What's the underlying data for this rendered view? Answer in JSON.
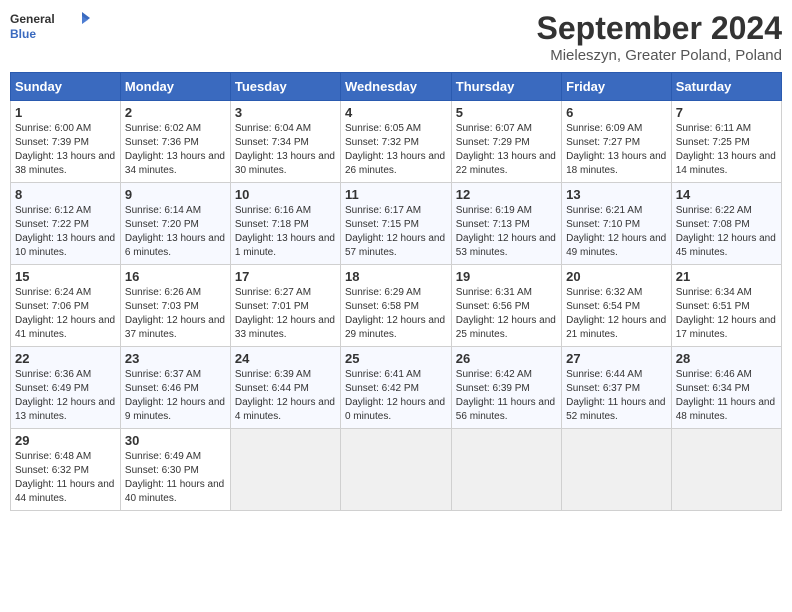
{
  "header": {
    "title": "September 2024",
    "subtitle": "Mieleszyn, Greater Poland, Poland",
    "logo_general": "General",
    "logo_blue": "Blue"
  },
  "days_of_week": [
    "Sunday",
    "Monday",
    "Tuesday",
    "Wednesday",
    "Thursday",
    "Friday",
    "Saturday"
  ],
  "weeks": [
    [
      {
        "day": "1",
        "sr": "6:00 AM",
        "ss": "7:39 PM",
        "dl": "13 hours and 38 minutes."
      },
      {
        "day": "2",
        "sr": "6:02 AM",
        "ss": "7:36 PM",
        "dl": "13 hours and 34 minutes."
      },
      {
        "day": "3",
        "sr": "6:04 AM",
        "ss": "7:34 PM",
        "dl": "13 hours and 30 minutes."
      },
      {
        "day": "4",
        "sr": "6:05 AM",
        "ss": "7:32 PM",
        "dl": "13 hours and 26 minutes."
      },
      {
        "day": "5",
        "sr": "6:07 AM",
        "ss": "7:29 PM",
        "dl": "13 hours and 22 minutes."
      },
      {
        "day": "6",
        "sr": "6:09 AM",
        "ss": "7:27 PM",
        "dl": "13 hours and 18 minutes."
      },
      {
        "day": "7",
        "sr": "6:11 AM",
        "ss": "7:25 PM",
        "dl": "13 hours and 14 minutes."
      }
    ],
    [
      {
        "day": "8",
        "sr": "6:12 AM",
        "ss": "7:22 PM",
        "dl": "13 hours and 10 minutes."
      },
      {
        "day": "9",
        "sr": "6:14 AM",
        "ss": "7:20 PM",
        "dl": "13 hours and 6 minutes."
      },
      {
        "day": "10",
        "sr": "6:16 AM",
        "ss": "7:18 PM",
        "dl": "13 hours and 1 minute."
      },
      {
        "day": "11",
        "sr": "6:17 AM",
        "ss": "7:15 PM",
        "dl": "12 hours and 57 minutes."
      },
      {
        "day": "12",
        "sr": "6:19 AM",
        "ss": "7:13 PM",
        "dl": "12 hours and 53 minutes."
      },
      {
        "day": "13",
        "sr": "6:21 AM",
        "ss": "7:10 PM",
        "dl": "12 hours and 49 minutes."
      },
      {
        "day": "14",
        "sr": "6:22 AM",
        "ss": "7:08 PM",
        "dl": "12 hours and 45 minutes."
      }
    ],
    [
      {
        "day": "15",
        "sr": "6:24 AM",
        "ss": "7:06 PM",
        "dl": "12 hours and 41 minutes."
      },
      {
        "day": "16",
        "sr": "6:26 AM",
        "ss": "7:03 PM",
        "dl": "12 hours and 37 minutes."
      },
      {
        "day": "17",
        "sr": "6:27 AM",
        "ss": "7:01 PM",
        "dl": "12 hours and 33 minutes."
      },
      {
        "day": "18",
        "sr": "6:29 AM",
        "ss": "6:58 PM",
        "dl": "12 hours and 29 minutes."
      },
      {
        "day": "19",
        "sr": "6:31 AM",
        "ss": "6:56 PM",
        "dl": "12 hours and 25 minutes."
      },
      {
        "day": "20",
        "sr": "6:32 AM",
        "ss": "6:54 PM",
        "dl": "12 hours and 21 minutes."
      },
      {
        "day": "21",
        "sr": "6:34 AM",
        "ss": "6:51 PM",
        "dl": "12 hours and 17 minutes."
      }
    ],
    [
      {
        "day": "22",
        "sr": "6:36 AM",
        "ss": "6:49 PM",
        "dl": "12 hours and 13 minutes."
      },
      {
        "day": "23",
        "sr": "6:37 AM",
        "ss": "6:46 PM",
        "dl": "12 hours and 9 minutes."
      },
      {
        "day": "24",
        "sr": "6:39 AM",
        "ss": "6:44 PM",
        "dl": "12 hours and 4 minutes."
      },
      {
        "day": "25",
        "sr": "6:41 AM",
        "ss": "6:42 PM",
        "dl": "12 hours and 0 minutes."
      },
      {
        "day": "26",
        "sr": "6:42 AM",
        "ss": "6:39 PM",
        "dl": "11 hours and 56 minutes."
      },
      {
        "day": "27",
        "sr": "6:44 AM",
        "ss": "6:37 PM",
        "dl": "11 hours and 52 minutes."
      },
      {
        "day": "28",
        "sr": "6:46 AM",
        "ss": "6:34 PM",
        "dl": "11 hours and 48 minutes."
      }
    ],
    [
      {
        "day": "29",
        "sr": "6:48 AM",
        "ss": "6:32 PM",
        "dl": "11 hours and 44 minutes."
      },
      {
        "day": "30",
        "sr": "6:49 AM",
        "ss": "6:30 PM",
        "dl": "11 hours and 40 minutes."
      },
      null,
      null,
      null,
      null,
      null
    ]
  ]
}
